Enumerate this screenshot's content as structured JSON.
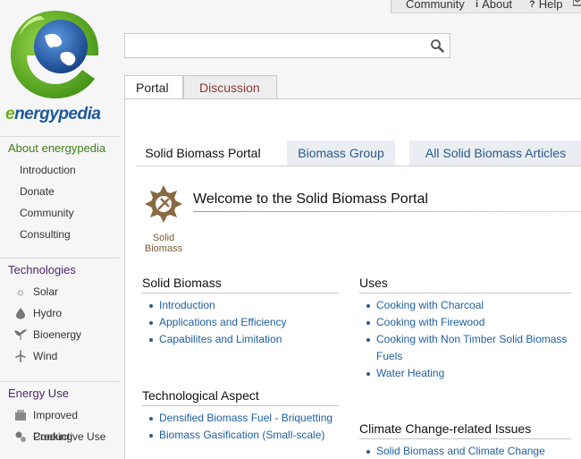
{
  "topnav": {
    "community": "Community",
    "about": "About",
    "help": "Help",
    "mail_icon": "mail-icon"
  },
  "logo": {
    "text_e": "e",
    "text_rest": "nergypedia"
  },
  "search": {
    "placeholder": "",
    "value": ""
  },
  "sidebar": {
    "about_heading": "About energypedia",
    "about_items": [
      "Introduction",
      "Donate",
      "Community",
      "Consulting"
    ],
    "tech_heading": "Technologies",
    "tech_items": [
      {
        "label": "Solar",
        "icon": "sun-icon"
      },
      {
        "label": "Hydro",
        "icon": "water-drop-icon"
      },
      {
        "label": "Bioenergy",
        "icon": "plant-icon"
      },
      {
        "label": "Wind",
        "icon": "wind-turbine-icon"
      }
    ],
    "energy_heading": "Energy Use",
    "energy_items": [
      {
        "label": "Improved Cooking",
        "icon": "stove-icon"
      },
      {
        "label": "Productive Use",
        "icon": "gears-icon"
      }
    ]
  },
  "page_tabs": {
    "portal": "Portal",
    "discussion": "Discussion"
  },
  "section_tabs": {
    "active": "Solid Biomass Portal",
    "group": "Biomass Group",
    "all": "All Solid Biomass Articles"
  },
  "welcome": {
    "title": "Welcome to the Solid Biomass Portal",
    "badge_line1": "Solid",
    "badge_line2": "Biomass"
  },
  "sections": {
    "solid_biomass": {
      "title": "Solid Biomass",
      "items": [
        "Introduction",
        "Applications and Efficiency",
        "Capabilites and Limitation"
      ]
    },
    "uses": {
      "title": "Uses",
      "items": [
        "Cooking with Charcoal",
        "Cooking with Firewood",
        "Cooking with Non Timber Solid Biomass",
        "Fuels",
        "Water Heating"
      ]
    },
    "tech_aspect": {
      "title": "Technological Aspect",
      "items": [
        "Densified Biomass Fuel - Briquetting",
        "Biomass Gasification (Small-scale)"
      ]
    },
    "climate": {
      "title": "Climate Change-related Issues",
      "items": [
        "Solid Biomass and Climate Change"
      ]
    }
  },
  "colors": {
    "link": "#1f5fa0",
    "heading_green": "#3d7f1a",
    "heading_purple": "#4a2a6e"
  }
}
